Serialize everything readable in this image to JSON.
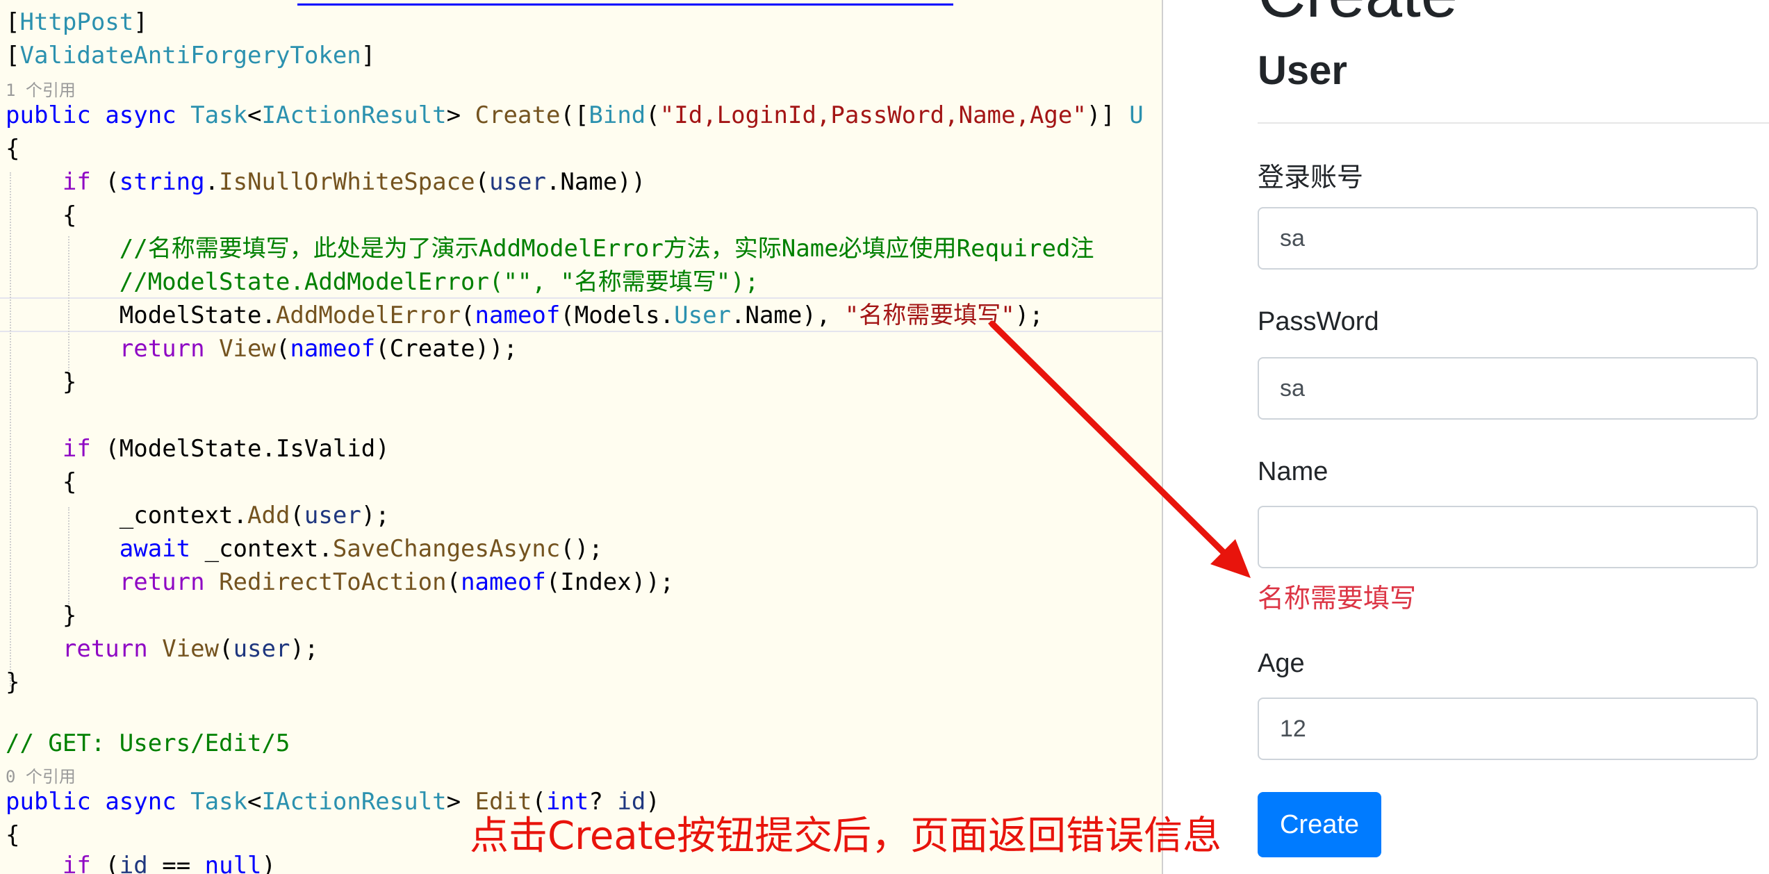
{
  "code": {
    "lines": [
      "[HttpPost]",
      "[ValidateAntiForgeryToken]",
      "public async Task<IActionResult> Create([Bind(\"Id,LoginId,PassWord,Name,Age\")] U",
      "{",
      "    if (string.IsNullOrWhiteSpace(user.Name))",
      "    {",
      "        //名称需要填写，此处是为了演示AddModelError方法，实际Name必填应使用Required注",
      "        //ModelState.AddModelError(\"\", \"名称需要填写\");",
      "        ModelState.AddModelError(nameof(Models.User.Name), \"名称需要填写\");",
      "        return View(nameof(Create));",
      "    }",
      "    if (ModelState.IsValid)",
      "    {",
      "        _context.Add(user);",
      "        await _context.SaveChangesAsync();",
      "        return RedirectToAction(nameof(Index));",
      "    }",
      "    return View(user);",
      "}",
      "// GET: Users/Edit/5",
      "public async Task<IActionResult> Edit(int? id)",
      "{",
      "    if (id == null)"
    ],
    "codelens": [
      "1 个引用",
      "0 个引用"
    ]
  },
  "page": {
    "heading": "Create",
    "subheading": "User",
    "fields": [
      {
        "label": "登录账号",
        "value": "sa"
      },
      {
        "label": "PassWord",
        "value": "sa"
      },
      {
        "label": "Name",
        "value": ""
      },
      {
        "label": "Age",
        "value": "12"
      }
    ],
    "name_error": "名称需要填写",
    "create_button": "Create"
  },
  "annotation": {
    "text": "点击Create按钮提交后，页面返回错误信息",
    "color": "#e8140c"
  },
  "colors": {
    "keyword": "#0000ff",
    "type": "#2b91af",
    "string": "#a31515",
    "comment": "#008000",
    "method": "#74531f",
    "control": "#8f08c4",
    "primary_button": "#007bff",
    "error": "#dc3545"
  }
}
